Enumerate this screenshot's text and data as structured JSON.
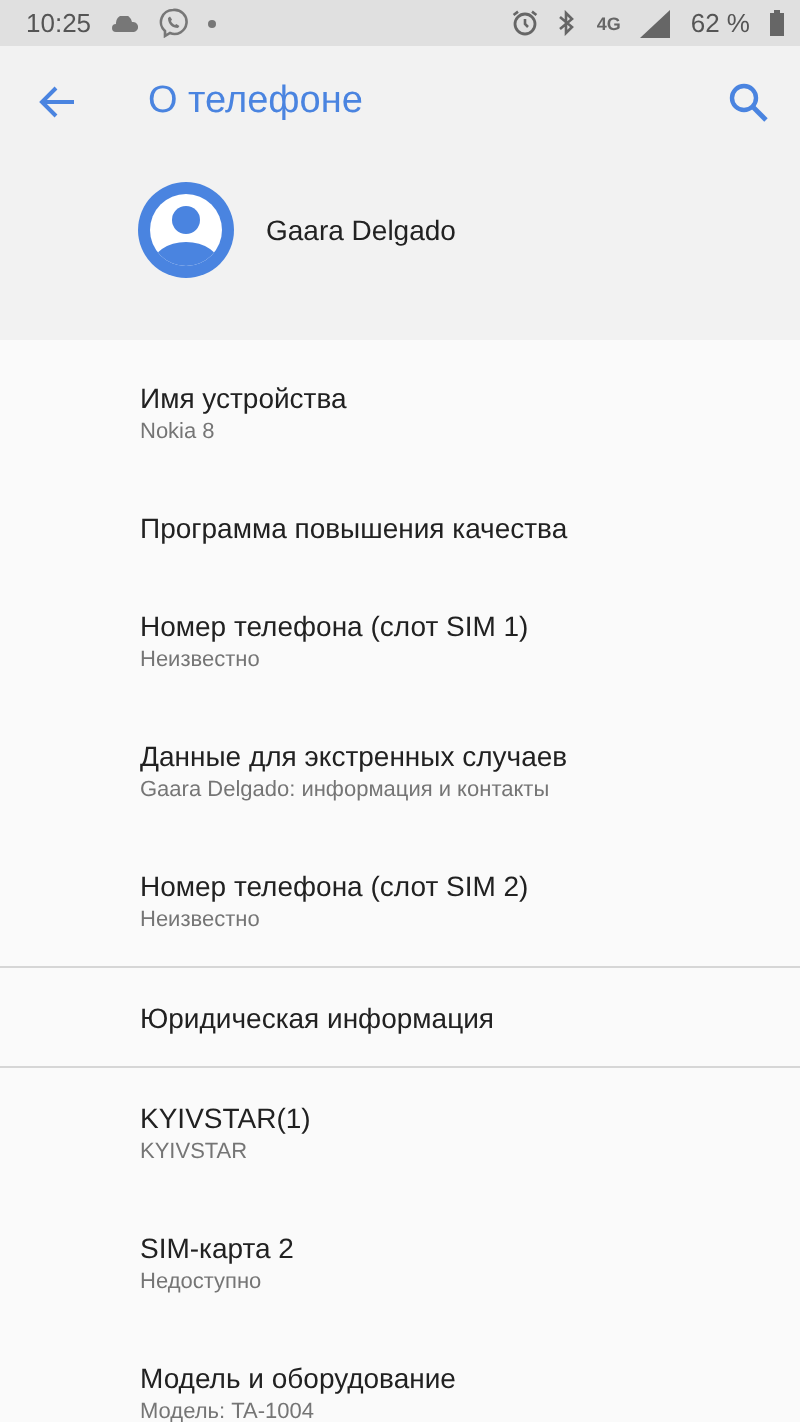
{
  "status_bar": {
    "time": "10:25",
    "network": "4G",
    "battery": "62 %"
  },
  "app_bar": {
    "title": "О телефоне"
  },
  "profile": {
    "name": "Gaara Delgado"
  },
  "groups": [
    {
      "items": [
        {
          "title": "Имя устройства",
          "subtitle": "Nokia 8"
        },
        {
          "title": "Программа повышения качества"
        },
        {
          "title": "Номер телефона (слот SIM 1)",
          "subtitle": "Неизвестно"
        },
        {
          "title": "Данные для экстренных случаев",
          "subtitle": "Gaara Delgado: информация и контакты"
        },
        {
          "title": "Номер телефона (слот SIM 2)",
          "subtitle": "Неизвестно"
        }
      ]
    },
    {
      "items": [
        {
          "title": "Юридическая информация"
        }
      ]
    },
    {
      "items": [
        {
          "title": "KYIVSTAR(1)",
          "subtitle": "KYIVSTAR"
        },
        {
          "title": "SIM-карта 2",
          "subtitle": "Недоступно"
        },
        {
          "title": "Модель и оборудование",
          "subtitle": "Модель: TA-1004"
        }
      ]
    }
  ]
}
